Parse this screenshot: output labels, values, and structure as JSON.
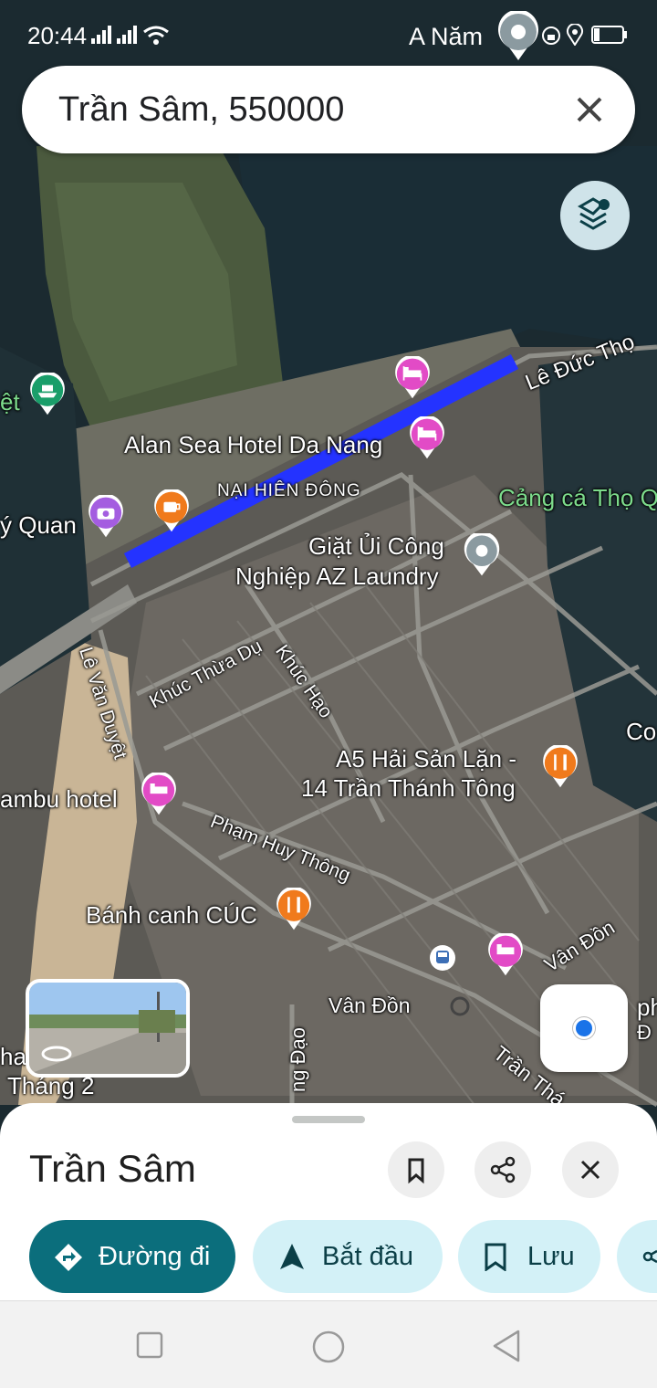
{
  "status": {
    "time": "20:44",
    "user": "A Năm"
  },
  "search": {
    "query": "Trần Sâm, 550000"
  },
  "map_labels": {
    "nai_hien_dong": "NẠI HIÊN ĐÔNG",
    "le_duc_tho": "Lê Đức Thọ",
    "alan_sea": "Alan Sea Hotel Da Nang",
    "cang_ca": "Cảng cá Thọ Q",
    "left_viet": "ệt",
    "quan": "ý Quan",
    "giat_ui_1": "Giặt Ủi Công",
    "giat_ui_2": "Nghiệp AZ Laundry",
    "le_van_duyet": "Lê Văn Duyệt",
    "khuc_thua_du": "Khúc Thừa Dụ",
    "khuc_hao": "Khúc Hạo",
    "co": "Co",
    "a5_1": "A5 Hải Sản Lặn -",
    "a5_2": "14 Trần Thánh Tông",
    "bambu": "ambu hotel",
    "pham_huy_thong": "Phạm Huy Thông",
    "banh_canh": "Bánh canh CÚC",
    "van_don_1": "Vân Đồn",
    "van_don_2": "Vân Đồn",
    "ng_dao": "ng Đạo",
    "tran_th": "Trần Thá",
    "ha": "ha",
    "thang2": "Tháng 2",
    "ph": "ph",
    "d": "Đ"
  },
  "place": {
    "title": "Trần Sâm"
  },
  "actions": {
    "directions": "Đường đi",
    "start": "Bắt đầu",
    "save": "Lưu"
  },
  "icons": [
    "signal-icon",
    "wifi-icon",
    "lock-icon",
    "location-icon",
    "battery-icon",
    "close-icon",
    "layers-icon",
    "hotel-icon",
    "restaurant-icon",
    "cafe-icon",
    "camera-icon",
    "ferry-icon",
    "bus-icon",
    "bookmark-icon",
    "share-icon",
    "directions-icon",
    "navigation-icon",
    "recents-icon",
    "home-icon",
    "back-icon"
  ],
  "colors": {
    "route": "#2433ff",
    "hotel": "#e24bc6",
    "food": "#f07a1c",
    "primary": "#0b6e7c",
    "chip": "#d3f1f7"
  }
}
